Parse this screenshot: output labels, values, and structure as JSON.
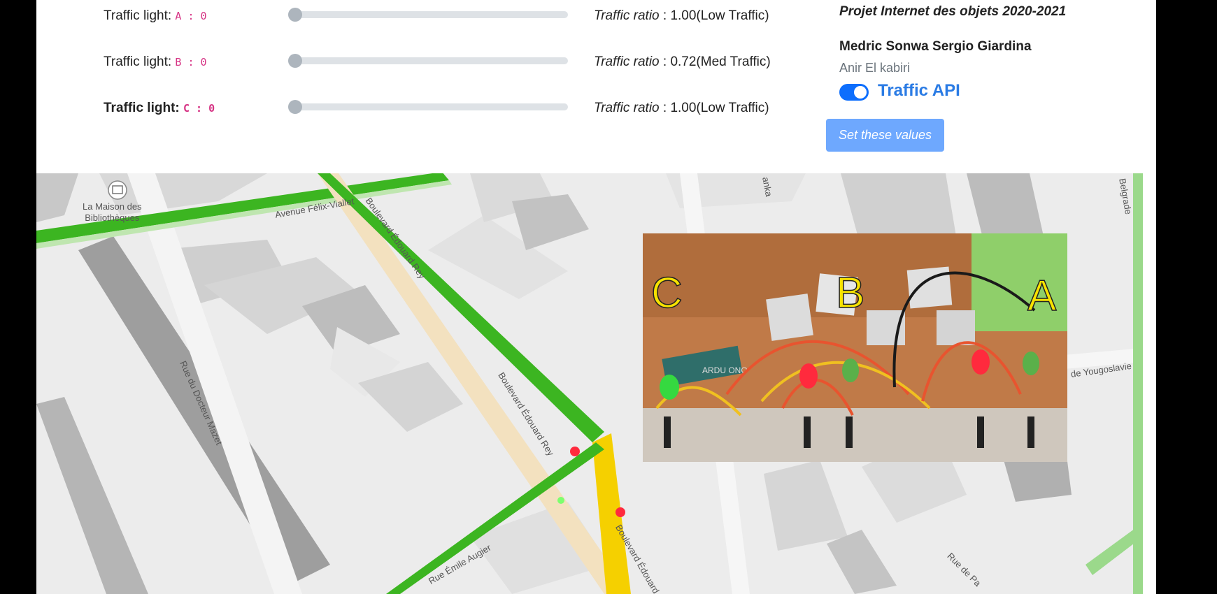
{
  "controls": {
    "lights": [
      {
        "prefix": "Traffic light: ",
        "id": "A",
        "sep": " : ",
        "value": "0",
        "ratio_label": "Traffic ratio",
        "ratio_text": " : 1.00(Low Traffic)",
        "slider_value": 0
      },
      {
        "prefix": "Traffic light: ",
        "id": "B",
        "sep": " : ",
        "value": "0",
        "ratio_label": "Traffic ratio",
        "ratio_text": " : 0.72(Med Traffic)",
        "slider_value": 0
      },
      {
        "prefix": "Traffic light: ",
        "id": "C",
        "sep": " : ",
        "value": "0",
        "ratio_label": "Traffic ratio",
        "ratio_text": " : 1.00(Low Traffic)",
        "slider_value": 0
      }
    ]
  },
  "info": {
    "title": "Projet Internet des objets 2020-2021",
    "author1": "Medric Sonwa Sergio Giardina",
    "author2": "Anir El kabiri",
    "toggle_label": "Traffic API",
    "toggle_on": true,
    "set_button": "Set these values"
  },
  "map": {
    "poi": "La Maison des Bibliothèques",
    "poi_line1": "La Maison des",
    "poi_line2": "Bibliothèques",
    "streets": {
      "felix": "Avenue Félix-Viallet",
      "edouard1": "Boulevard Édouard Rey",
      "edouard2": "Boulevard Édouard Rey",
      "edouard3": "Boulevard Édouard",
      "mazet": "Rue du Docteur Mazet",
      "augier": "Rue Émile Augier",
      "yougoslavie": "de Yougoslavie",
      "belgrade": "Belgrade",
      "anka": "anka",
      "rue_de_p": "Rue de Pa"
    }
  },
  "photo": {
    "labels": [
      "C",
      "B",
      "A"
    ],
    "board_text": "ARDU ONO"
  },
  "colors": {
    "accent": "#0d6efd",
    "road_green": "#3cb521",
    "road_yellow": "#f5d000",
    "led_red": "#ff2a3d",
    "led_green": "#35d940"
  }
}
